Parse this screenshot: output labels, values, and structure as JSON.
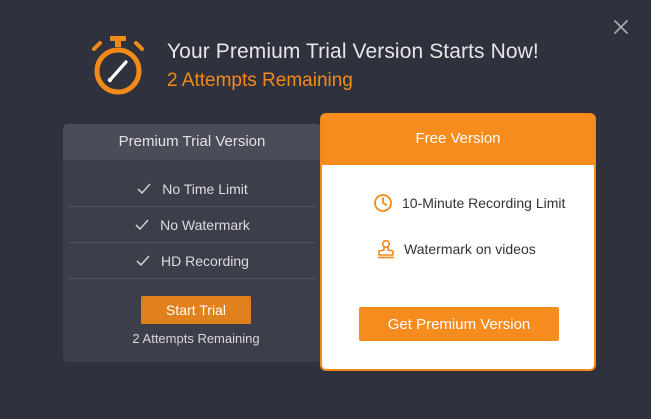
{
  "header": {
    "title": "Your Premium Trial Version Starts Now!",
    "subtitle": "2 Attempts Remaining",
    "icon": "stopwatch-icon"
  },
  "trial_panel": {
    "title": "Premium Trial Version",
    "features": [
      {
        "label": "No Time Limit",
        "icon": "checkmark-icon"
      },
      {
        "label": "No Watermark",
        "icon": "checkmark-icon"
      },
      {
        "label": "HD Recording",
        "icon": "checkmark-icon"
      }
    ],
    "button_label": "Start Trial",
    "footer": "2 Attempts Remaining"
  },
  "free_panel": {
    "title": "Free Version",
    "items": [
      {
        "label": "10-Minute Recording Limit",
        "icon": "clock-icon"
      },
      {
        "label": "Watermark on videos",
        "icon": "stamp-icon"
      }
    ],
    "button_label": "Get Premium Version"
  },
  "colors": {
    "background": "#2f313c",
    "accent": "#f68b1e",
    "panel": "#3c3e49",
    "panel_header": "#4a4c57"
  }
}
